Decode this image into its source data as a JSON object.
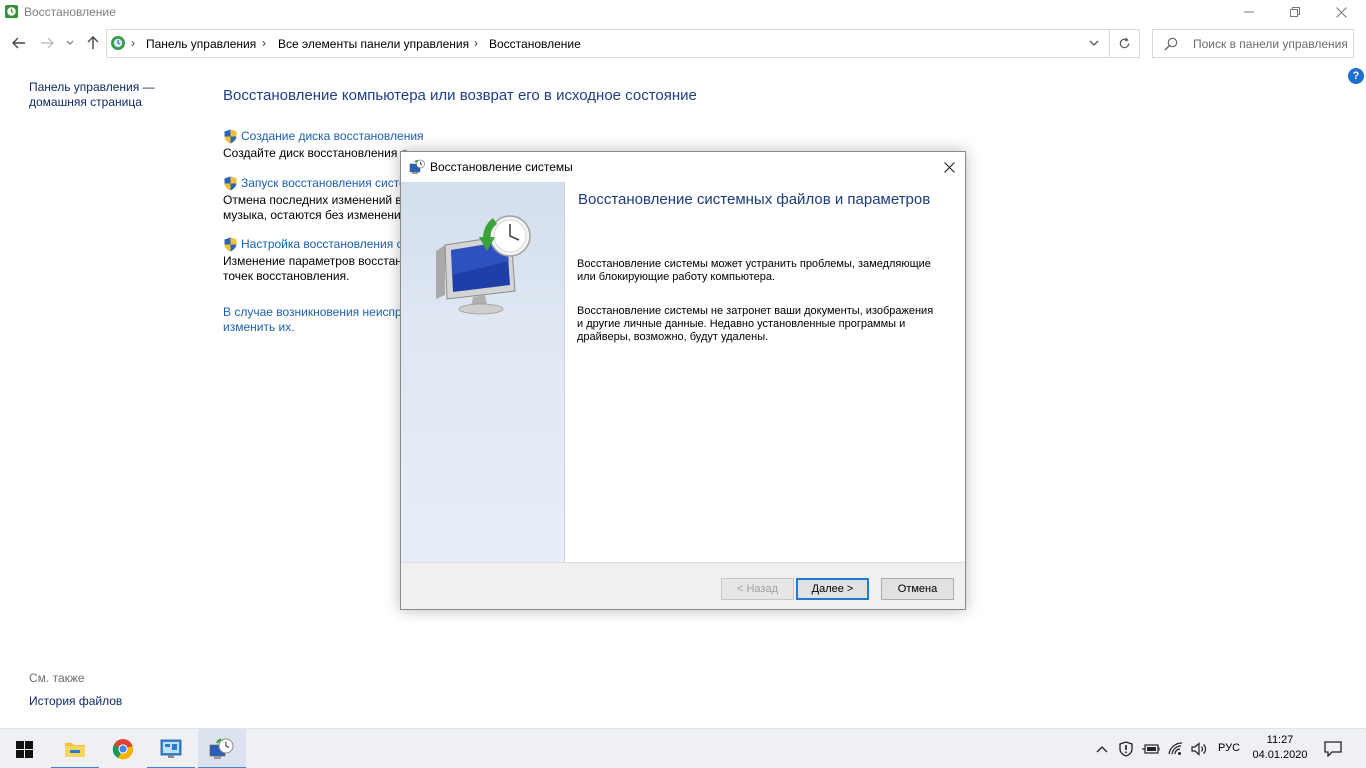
{
  "window": {
    "title": "Восстановление"
  },
  "address": {
    "crumbs": [
      "Панель управления",
      "Все элементы панели управления",
      "Восстановление"
    ],
    "search_placeholder": "Поиск в панели управления"
  },
  "leftnav": {
    "home": "Панель управления — домашняя страница",
    "see_also": "См. также",
    "file_history": "История файлов"
  },
  "main": {
    "title": "Восстановление компьютера или возврат его в исходное состояние",
    "tasks": [
      {
        "link": "Создание диска восстановления",
        "desc": "Создайте диск восстановления д"
      },
      {
        "link": "Запуск восстановления систе",
        "desc": "Отмена последних изменений в",
        "desc2": "музыка, остаются без изменени"
      },
      {
        "link": "Настройка восстановления с",
        "desc": "Изменение параметров восстан",
        "desc2": "точек восстановления."
      }
    ],
    "bottom_link_1": "В случае возникновения неиспр",
    "bottom_link_2": "изменить их."
  },
  "dialog": {
    "title": "Восстановление системы",
    "heading": "Восстановление системных файлов и параметров",
    "para1": "Восстановление системы может устранить проблемы, замедляющие или блокирующие работу компьютера.",
    "para2": "Восстановление системы не затронет ваши документы, изображения и другие личные данные. Недавно установленные программы и драйверы, возможно, будут удалены.",
    "back_label": "< Назад",
    "next_label": "Далее >",
    "cancel_label": "Отмена"
  },
  "taskbar": {
    "lang": "РУС",
    "time": "11:27",
    "date": "04.01.2020"
  },
  "colors": {
    "link": "#1a5fb4",
    "heading": "#1e3f8a",
    "accent": "#1e7ad6"
  }
}
